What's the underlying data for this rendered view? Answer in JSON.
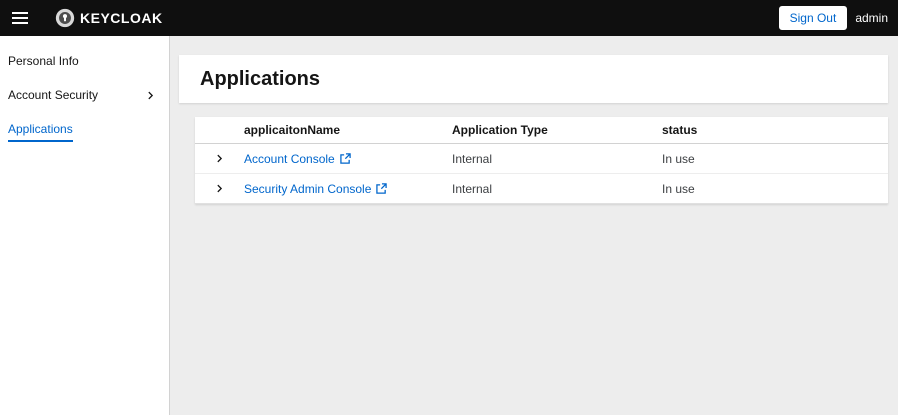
{
  "header": {
    "brand": "KEYCLOAK",
    "sign_out_label": "Sign Out",
    "username": "admin"
  },
  "sidebar": {
    "items": [
      {
        "label": "Personal Info"
      },
      {
        "label": "Account Security"
      },
      {
        "label": "Applications"
      }
    ]
  },
  "main": {
    "page_title": "Applications",
    "table": {
      "columns": [
        "applicaitonName",
        "Application Type",
        "status"
      ],
      "rows": [
        {
          "name": "Account Console",
          "type": "Internal",
          "status": "In use"
        },
        {
          "name": "Security Admin Console",
          "type": "Internal",
          "status": "In use"
        }
      ]
    }
  },
  "colors": {
    "accent": "#0066cc",
    "header_bg": "#0f0f0f",
    "page_bg": "#ededed"
  }
}
